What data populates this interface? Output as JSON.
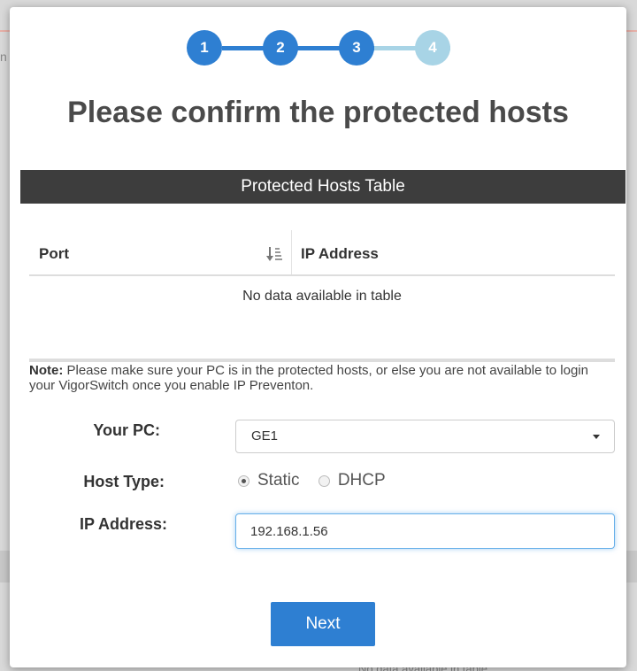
{
  "background": {
    "left_fragment": "n",
    "bottom_fragment": "No data available in table"
  },
  "stepper": {
    "steps": [
      {
        "label": "1",
        "state": "done"
      },
      {
        "label": "2",
        "state": "done"
      },
      {
        "label": "3",
        "state": "done"
      },
      {
        "label": "4",
        "state": "todo"
      }
    ],
    "colors": {
      "done": "#2e7fd2",
      "todo": "#a8d4e6"
    }
  },
  "title": "Please confirm the protected hosts",
  "table": {
    "caption": "Protected Hosts Table",
    "columns": [
      "Port",
      "IP Address"
    ],
    "sort_icon": "sort-numeric-down-icon",
    "empty_message": "No data available in table"
  },
  "note": {
    "label": "Note:",
    "text": " Please make sure your PC is in the protected hosts, or else you are not available to login your VigorSwitch once you enable IP Preventon."
  },
  "form": {
    "your_pc": {
      "label": "Your PC:",
      "value": "GE1"
    },
    "host_type": {
      "label": "Host Type:",
      "options": [
        "Static",
        "DHCP"
      ],
      "selected": "Static"
    },
    "ip_address": {
      "label": "IP Address:",
      "value": "192.168.1.56"
    }
  },
  "next_label": "Next"
}
